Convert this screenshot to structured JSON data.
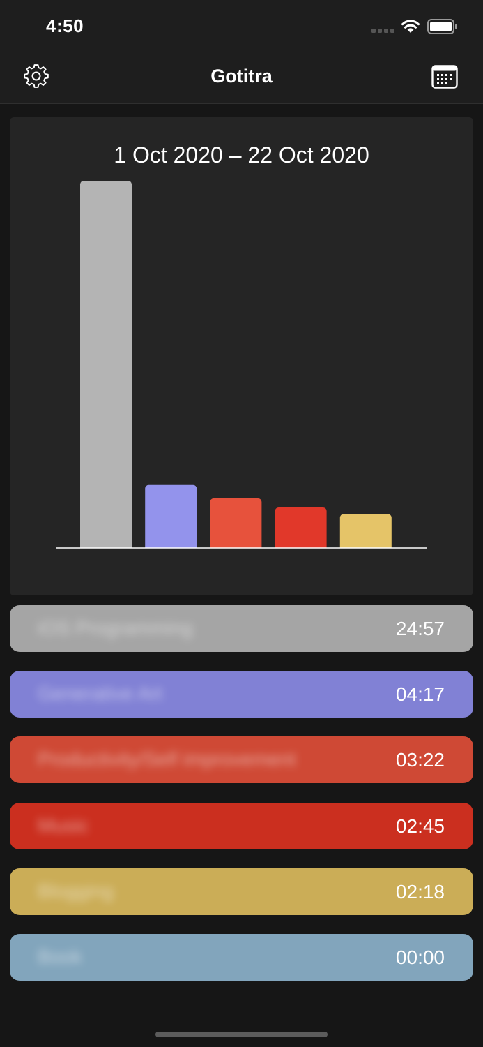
{
  "status_bar": {
    "time": "4:50",
    "icons": [
      "signal-icon",
      "wifi-icon",
      "battery-icon"
    ]
  },
  "nav": {
    "title": "Gotitra",
    "left_icon": "gear-icon",
    "right_icon": "calendar-icon"
  },
  "chart_data": {
    "type": "bar",
    "title": "1 Oct 2020 – 22 Oct 2020",
    "xlabel": "",
    "ylabel": "",
    "categories": [
      "iOS Programming",
      "Generative Art",
      "Productivity/Self improvement",
      "Music",
      "Blogging"
    ],
    "values": [
      24.95,
      4.28,
      3.37,
      2.75,
      2.3
    ],
    "colors": [
      "#b4b4b4",
      "#9393ec",
      "#e7523c",
      "#e1382a",
      "#e5c468"
    ],
    "ylim": [
      0,
      25
    ],
    "grid": false,
    "legend": "none"
  },
  "entries": [
    {
      "label": "iOS Programming",
      "time": "24:57",
      "color": "#a5a5a5"
    },
    {
      "label": "Generative Art",
      "time": "04:17",
      "color": "#8181d5"
    },
    {
      "label": "Productivity/Self improvement",
      "time": "03:22",
      "color": "#cf4935"
    },
    {
      "label": "Music",
      "time": "02:45",
      "color": "#cb2f1f"
    },
    {
      "label": "Blogging",
      "time": "02:18",
      "color": "#cbad57"
    },
    {
      "label": "Book",
      "time": "00:00",
      "color": "#82a5bc"
    }
  ]
}
